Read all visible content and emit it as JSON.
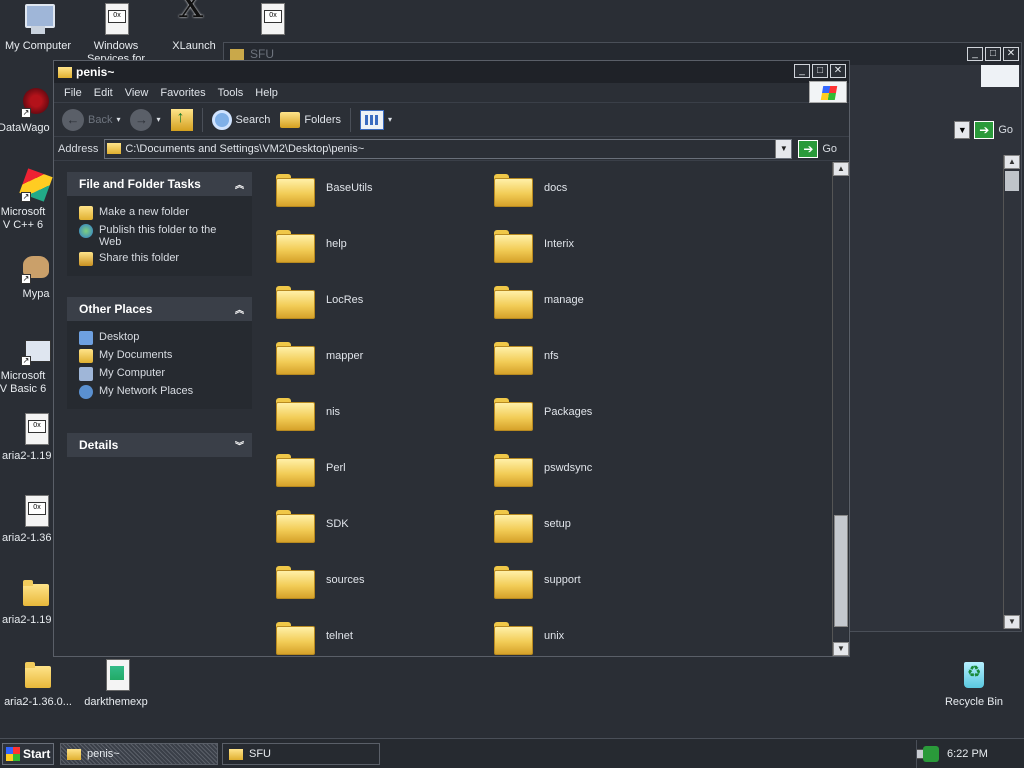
{
  "desktop_icons": [
    {
      "label": "My Computer",
      "icon": "my-computer-icon"
    },
    {
      "label": "Windows Services for",
      "icon": "document-icon"
    },
    {
      "label": "XLaunch",
      "icon": "xlaunch-icon"
    },
    {
      "label": "",
      "icon": "document-icon"
    },
    {
      "label": "DataWago",
      "icon": "datawago-icon"
    },
    {
      "label": "Microsoft V C++ 6",
      "icon": "visual-cpp-icon"
    },
    {
      "label": "Mypa",
      "icon": "mypa-icon"
    },
    {
      "label": "Microsoft V Basic 6",
      "icon": "visual-basic-icon"
    },
    {
      "label": "aria2-1.19",
      "icon": "document-icon"
    },
    {
      "label": "aria2-1.36",
      "icon": "document-icon"
    },
    {
      "label": "aria2-1.19",
      "icon": "folder-icon"
    },
    {
      "label": "aria2-1.36.0...",
      "icon": "folder-icon"
    },
    {
      "label": "darkthemexp",
      "icon": "image-file-icon"
    },
    {
      "label": "Recycle Bin",
      "icon": "recycle-bin-icon"
    }
  ],
  "back_window": {
    "title": "SFU",
    "go_label": "Go"
  },
  "window": {
    "title": "penis~",
    "menu": [
      "File",
      "Edit",
      "View",
      "Favorites",
      "Tools",
      "Help"
    ],
    "toolbar": {
      "back": "Back",
      "search": "Search",
      "folders": "Folders"
    },
    "address": {
      "label": "Address",
      "value": "C:\\Documents and Settings\\VM2\\Desktop\\penis~",
      "go": "Go"
    },
    "tasks_panel": {
      "title": "File and Folder Tasks",
      "items": [
        "Make a new folder",
        "Publish this folder to the Web",
        "Share this folder"
      ]
    },
    "places_panel": {
      "title": "Other Places",
      "items": [
        "Desktop",
        "My Documents",
        "My Computer",
        "My Network Places"
      ]
    },
    "details_panel": {
      "title": "Details"
    },
    "folders": [
      "BaseUtils",
      "docs",
      "help",
      "Interix",
      "LocRes",
      "manage",
      "mapper",
      "nfs",
      "nis",
      "Packages",
      "Perl",
      "pswdsync",
      "SDK",
      "setup",
      "sources",
      "support",
      "telnet",
      "unix"
    ]
  },
  "taskbar": {
    "start": "Start",
    "buttons": [
      "penis~",
      "SFU"
    ],
    "clock": "6:22 PM"
  }
}
